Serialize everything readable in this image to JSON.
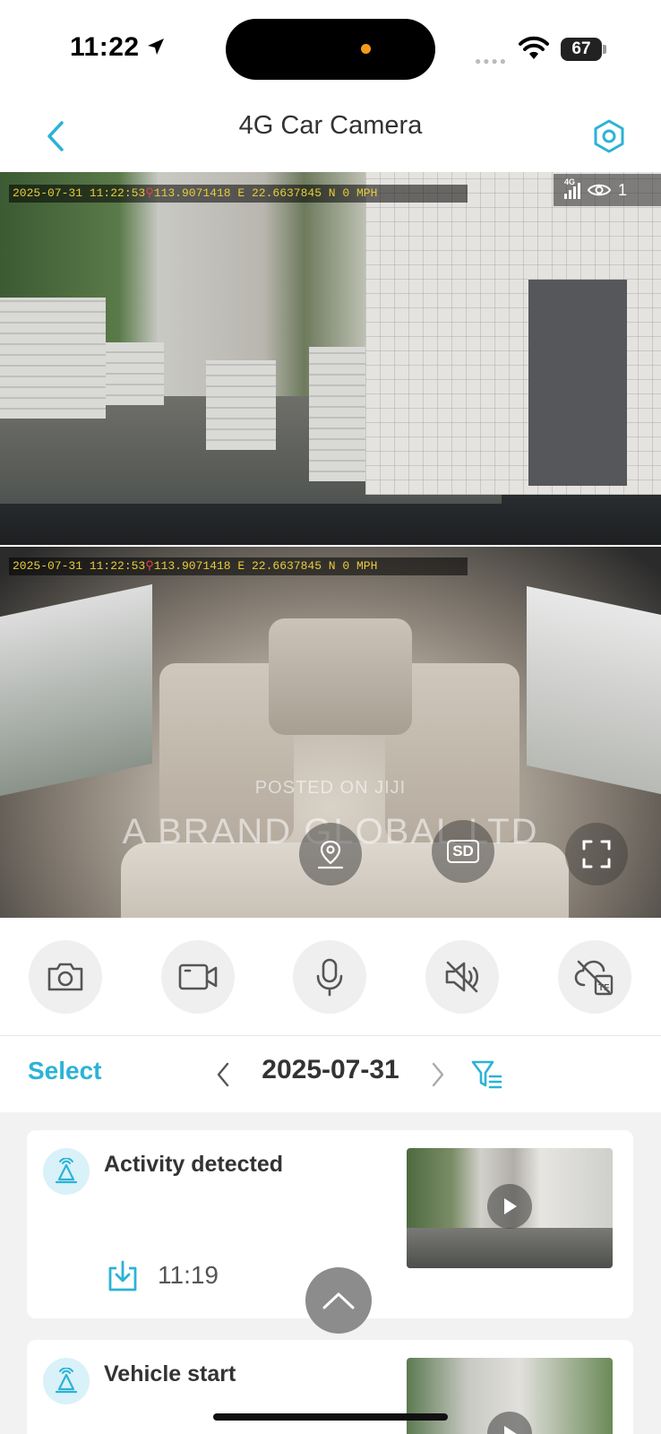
{
  "status_bar": {
    "time": "11:22",
    "battery": "67",
    "icons": [
      "location-arrow-icon",
      "wifi-icon",
      "battery-icon"
    ]
  },
  "header": {
    "title": "4G Car Camera",
    "back_icon": "chevron-left-icon",
    "settings_icon": "settings-hexagon-icon",
    "accent_color": "#2bb3d6"
  },
  "video": {
    "front_osd": {
      "datetime": "2025-07-31 11:22:53",
      "coords": "113.9071418 E 22.6637845 N 0 MPH"
    },
    "rear_osd": {
      "datetime": "2025-07-31 11:22:53",
      "coords": "113.9071418 E 22.6637845 N 0 MPH"
    },
    "network": "4G",
    "viewers": "1",
    "watermark_small": "POSTED ON JIJI",
    "watermark_large": "A BRAND GLOBAL LTD",
    "sd_label": "SD"
  },
  "toolbar": {
    "tools": [
      "camera-icon",
      "video-record-icon",
      "microphone-icon",
      "speaker-muted-icon",
      "cloud-tf-icon"
    ]
  },
  "date_bar": {
    "select_label": "Select",
    "date": "2025-07-31"
  },
  "events": [
    {
      "title": "Activity detected",
      "time": "11:19",
      "icon": "motion-alert-icon"
    },
    {
      "title": "Vehicle start",
      "time": "",
      "icon": "motion-alert-icon"
    }
  ]
}
